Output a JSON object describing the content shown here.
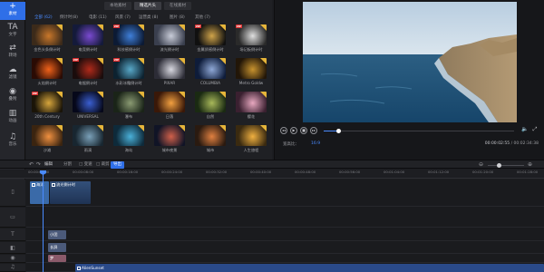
{
  "rail": [
    {
      "icon": "+",
      "icon_name": "add-media-icon",
      "label": "素材"
    },
    {
      "icon": "TA",
      "icon_name": "text-icon",
      "label": "文字"
    },
    {
      "icon": "⇄",
      "icon_name": "transition-icon",
      "label": "转场"
    },
    {
      "icon": "☁",
      "icon_name": "filter-icon",
      "label": "滤镜"
    },
    {
      "icon": "◉",
      "icon_name": "overlay-icon",
      "label": "叠附"
    },
    {
      "icon": "▥",
      "icon_name": "element-icon",
      "label": "动画"
    },
    {
      "icon": "♫",
      "icon_name": "music-icon",
      "label": "音乐"
    }
  ],
  "subtabs": [
    "本地素材",
    "精选片头",
    "在线素材"
  ],
  "categories": [
    "全部 (62)",
    "倒计时(8)",
    "电影 (11)",
    "风景 (7)",
    "运营类 (8)",
    "图片 (8)",
    "其他 (7)"
  ],
  "tiles": [
    {
      "caption": "金色头条倒计时",
      "vip": false,
      "colors": [
        "#3b2a1a",
        "#c9772a"
      ]
    },
    {
      "caption": "电竞倒计时",
      "vip": false,
      "colors": [
        "#141a3a",
        "#7a4ad0"
      ]
    },
    {
      "caption": "科技感倒计时",
      "vip": true,
      "colors": [
        "#0c1a34",
        "#3f7fd9"
      ]
    },
    {
      "caption": "流光倒计时",
      "vip": false,
      "colors": [
        "#3a3f4e",
        "#c8ccd8"
      ]
    },
    {
      "caption": "金属质感倒计时",
      "vip": true,
      "colors": [
        "#101010",
        "#d0a44a"
      ]
    },
    {
      "caption": "场记板倒计时",
      "vip": true,
      "colors": [
        "#2a2a2a",
        "#e0e0e0"
      ]
    },
    {
      "caption": "火焰倒计时",
      "vip": false,
      "colors": [
        "#2a0b04",
        "#f0621a"
      ]
    },
    {
      "caption": "电锯倒计时",
      "vip": true,
      "colors": [
        "#1a0c0c",
        "#b02a1a"
      ]
    },
    {
      "caption": "水彩冰霜倒计时",
      "vip": true,
      "colors": [
        "#0d2230",
        "#58a8c8"
      ]
    },
    {
      "caption": "PIXAR",
      "vip": false,
      "colors": [
        "#2c2c36",
        "#d8d8e0"
      ]
    },
    {
      "caption": "COLUMBIA",
      "vip": false,
      "colors": [
        "#0e1c3a",
        "#8fa8d6"
      ]
    },
    {
      "caption": "Metro Goldw",
      "vip": false,
      "colors": [
        "#221608",
        "#c7922e"
      ]
    },
    {
      "caption": "20th Century",
      "vip": true,
      "colors": [
        "#1a1408",
        "#d6a53c"
      ]
    },
    {
      "caption": "UNIVERSAL",
      "vip": false,
      "colors": [
        "#06081a",
        "#3a5ed0"
      ]
    },
    {
      "caption": "瀑布",
      "vip": false,
      "colors": [
        "#1a2418",
        "#8a9a72"
      ]
    },
    {
      "caption": "日落",
      "vip": false,
      "colors": [
        "#3a1808",
        "#f2a040"
      ]
    },
    {
      "caption": "自然",
      "vip": false,
      "colors": [
        "#1a2a12",
        "#a8b85a"
      ]
    },
    {
      "caption": "樱花",
      "vip": false,
      "colors": [
        "#3a2030",
        "#e8a8c0"
      ]
    },
    {
      "caption": "沙滩",
      "vip": false,
      "colors": [
        "#3a2410",
        "#f09040"
      ]
    },
    {
      "caption": "雨滴",
      "vip": false,
      "colors": [
        "#182630",
        "#7aa0b8"
      ]
    },
    {
      "caption": "海岛",
      "vip": false,
      "colors": [
        "#0e2a3a",
        "#4ab0d8"
      ]
    },
    {
      "caption": "城市夜景",
      "vip": false,
      "colors": [
        "#101426",
        "#d0604a"
      ]
    },
    {
      "caption": "城市",
      "vip": false,
      "colors": [
        "#2a1a10",
        "#e08040"
      ]
    },
    {
      "caption": "人生旅程",
      "vip": false,
      "colors": [
        "#3a2a10",
        "#f0b040"
      ]
    }
  ],
  "preview": {
    "ratio_label": "宽高比：",
    "ratio_value": "16:9",
    "current_time": "00:00:02:55",
    "total_time": "00:02:34:38",
    "time_separator": " / ",
    "progress": 0.08
  },
  "controls": {
    "prev": "◂◂",
    "play": "▶",
    "stop": "■",
    "next": "▸▸",
    "volume": "🔈",
    "fullscreen": "⤢"
  },
  "toolbar": {
    "undo": "↶",
    "redo": "↷",
    "edit": "编辑",
    "split": "分割",
    "speed": "□ 变速",
    "crop": "□ 裁剪",
    "export": "导出",
    "zoom_out": "⊖",
    "zoom_in": "⊕",
    "zoom_level": 0.25
  },
  "ruler": [
    "00:00:00:00",
    "00:00:08:00",
    "00:00:16:00",
    "00:00:24:00",
    "00:00:32:00",
    "00:00:40:00",
    "00:00:48:00",
    "00:00:56:00",
    "00:01:04:00",
    "00:01:12:00",
    "00:01:20:00",
    "00:01:28:00"
  ],
  "clips": {
    "video_a": "海洋",
    "video_b": "流光倒计时",
    "text_a": "小团",
    "text_b": "长屏",
    "overlay": "梦",
    "audio": "AlienSunset"
  },
  "colors": {
    "accent": "#2f6fe8",
    "vip": "#d92d2d",
    "audio_clip": "#2a4a8a",
    "video_clip": "#3a6aa8"
  }
}
